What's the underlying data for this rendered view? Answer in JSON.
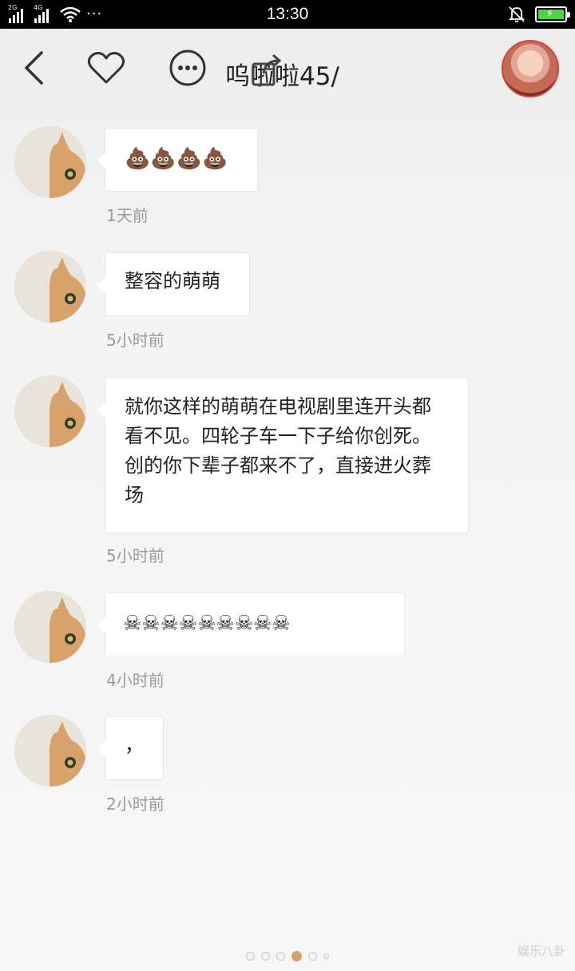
{
  "status_bar": {
    "network_1": "2G",
    "network_2": "4G",
    "more_dots": "···",
    "time": "13:30",
    "battery_level": 0.85,
    "battery_color": "#4cd443",
    "icons": [
      "signal-icon",
      "wifi-icon",
      "bell-muted-icon",
      "battery-charging-icon"
    ]
  },
  "header": {
    "title": "呜啦啦45/",
    "icons": [
      "back-icon",
      "heart-icon",
      "more-icon",
      "share-icon",
      "avatar"
    ]
  },
  "messages": [
    {
      "text": "💩💩💩💩",
      "time": "1天前"
    },
    {
      "text": "整容的萌萌",
      "time": "5小时前"
    },
    {
      "text": "就你这样的萌萌在电视剧里连开头都看不见。四轮子车一下子给你创死。创的你下辈子都来不了，直接进火葬场",
      "time": "5小时前"
    },
    {
      "text": "☠☠☠☠☠☠☠☠☠",
      "time": "4小时前"
    },
    {
      "text": "，",
      "time": "2小时前"
    }
  ],
  "pagination": {
    "total": 6,
    "active_index": 3
  },
  "watermark": "娱乐八卦",
  "colors": {
    "accent_dot": "#d9a06a",
    "bubble": "#ffffff",
    "time_text": "#9a9a9a"
  }
}
